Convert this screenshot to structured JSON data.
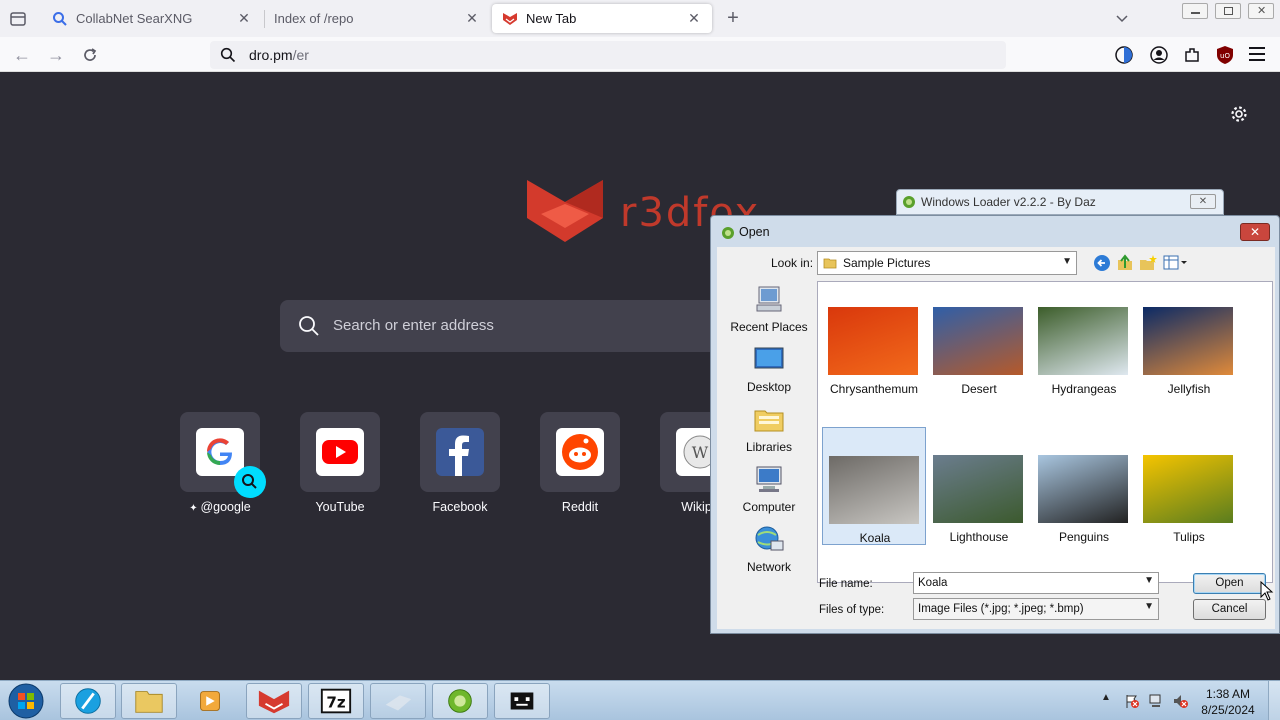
{
  "browser": {
    "tabs": [
      {
        "title": "CollabNet SearXNG",
        "active": false
      },
      {
        "title": "Index of /repo",
        "active": false
      },
      {
        "title": "New Tab",
        "active": true
      }
    ],
    "url_main": "dro.pm",
    "url_path": "/er"
  },
  "newtab": {
    "logo_text": "r3dfox",
    "search_placeholder": "Search or enter address",
    "shortcuts": [
      {
        "label": "@google",
        "icon": "google-icon"
      },
      {
        "label": "YouTube",
        "icon": "youtube-icon"
      },
      {
        "label": "Facebook",
        "icon": "facebook-icon"
      },
      {
        "label": "Reddit",
        "icon": "reddit-icon"
      },
      {
        "label": "Wikipe",
        "icon": "wikipedia-icon"
      }
    ]
  },
  "loader": {
    "title": "Windows Loader v2.2.2 - By Daz"
  },
  "dialog": {
    "title": "Open",
    "look_in_label": "Look in:",
    "look_in_value": "Sample Pictures",
    "places": [
      "Recent Places",
      "Desktop",
      "Libraries",
      "Computer",
      "Network"
    ],
    "files": [
      {
        "name": "Chrysanthemum",
        "colors": [
          "#d9380c",
          "#f26a1b"
        ]
      },
      {
        "name": "Desert",
        "colors": [
          "#2f5fa8",
          "#b65a2a"
        ]
      },
      {
        "name": "Hydrangeas",
        "colors": [
          "#3c5d2a",
          "#dfe8f0"
        ]
      },
      {
        "name": "Jellyfish",
        "colors": [
          "#0b2a66",
          "#e08a3a"
        ]
      },
      {
        "name": "Koala",
        "colors": [
          "#6d6a66",
          "#c8c6c2"
        ],
        "selected": true
      },
      {
        "name": "Lighthouse",
        "colors": [
          "#6b7d8e",
          "#3c5a2e"
        ]
      },
      {
        "name": "Penguins",
        "colors": [
          "#a9c6e0",
          "#222222"
        ]
      },
      {
        "name": "Tulips",
        "colors": [
          "#f5c400",
          "#5a7d1e"
        ]
      }
    ],
    "file_name_label": "File name:",
    "file_name_value": "Koala",
    "file_type_label": "Files of type:",
    "file_type_value": "Image Files (*.jpg; *.jpeg; *.bmp)",
    "open_label": "Open",
    "cancel_label": "Cancel"
  },
  "taskbar": {
    "time": "1:38 AM",
    "date": "8/25/2024"
  }
}
